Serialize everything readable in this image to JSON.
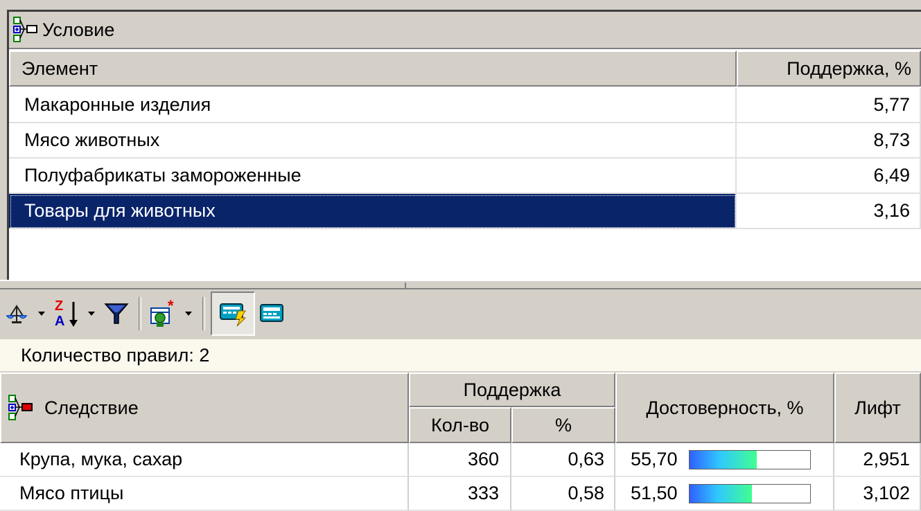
{
  "condition_panel": {
    "title": "Условие",
    "columns": {
      "element": "Элемент",
      "support": "Поддержка, %"
    },
    "rows": [
      {
        "element": "Макаронные изделия",
        "support": "5,77"
      },
      {
        "element": "Мясо животных",
        "support": "8,73"
      },
      {
        "element": "Полуфабрикаты замороженные",
        "support": "6,49"
      },
      {
        "element": "Товары для животных",
        "support": "3,16",
        "selected": true
      }
    ]
  },
  "toolbar": {
    "icons": [
      "scales-icon",
      "sort-za-icon",
      "filter-funnel-icon",
      "rule-wizard-icon",
      "keyboard-lightning-icon",
      "keyboard-icon"
    ]
  },
  "info": {
    "rules_count": "Количество правил: 2"
  },
  "rules_table": {
    "headers": {
      "consequence": "Следствие",
      "support": "Поддержка",
      "count": "Кол-во",
      "percent": "%",
      "confidence": "Достоверность, %",
      "lift": "Лифт"
    },
    "rows": [
      {
        "consequence": "Крупа, мука, сахар",
        "count": "360",
        "percent": "0,63",
        "confidence": "55,70",
        "confidence_value": 55.7,
        "lift": "2,951"
      },
      {
        "consequence": "Мясо птицы",
        "count": "333",
        "percent": "0,58",
        "confidence": "51,50",
        "confidence_value": 51.5,
        "lift": "3,102"
      }
    ]
  },
  "colors": {
    "selection": "#0a246a",
    "window": "#d4d0c8",
    "info_bar": "#fbf8ee"
  }
}
